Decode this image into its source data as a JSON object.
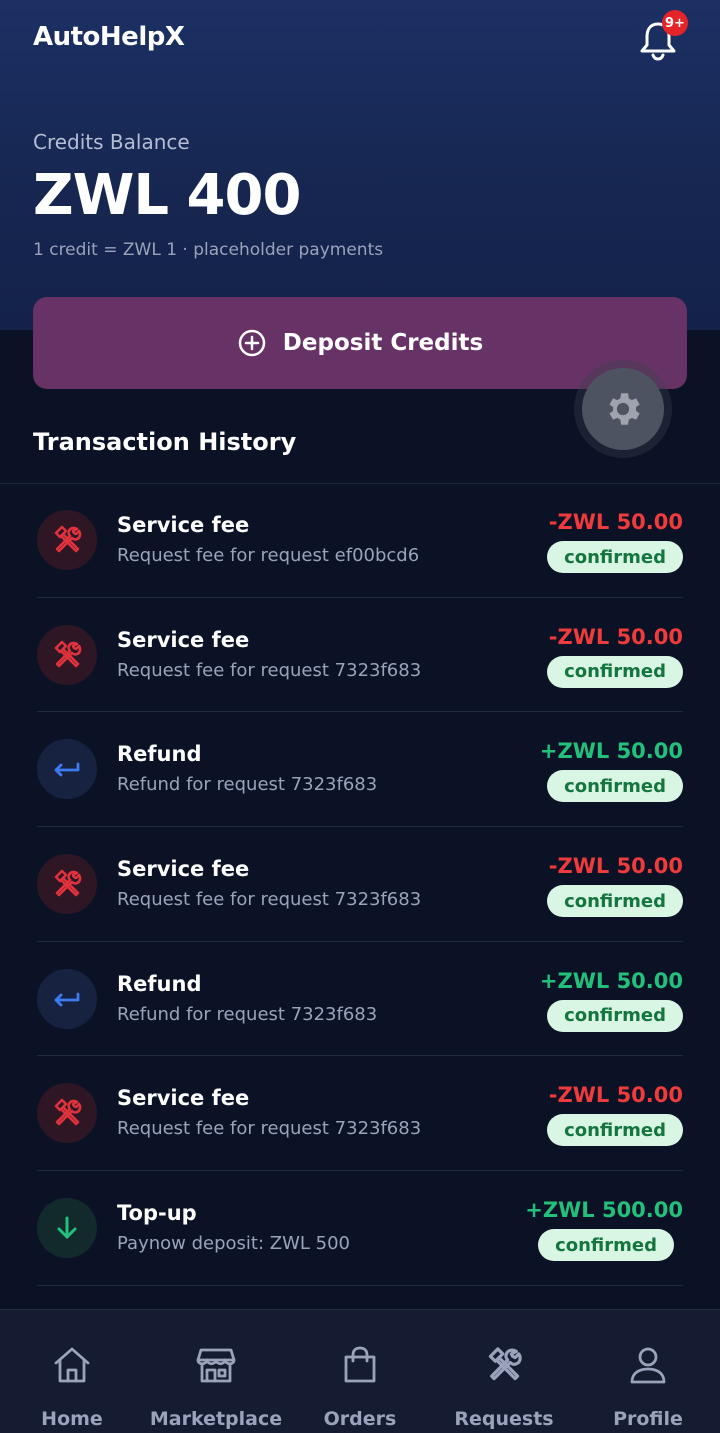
{
  "header": {
    "app_title": "AutoHelpX",
    "notification_badge": "9+"
  },
  "balance": {
    "label": "Credits Balance",
    "value": "ZWL 400",
    "note": "1 credit = ZWL 1 · placeholder payments"
  },
  "deposit": {
    "label": "Deposit Credits"
  },
  "history": {
    "title": "Transaction History",
    "transactions": [
      {
        "type": "fee",
        "icon": "tools-icon",
        "title": "Service fee",
        "description": "Request fee for request ef00bcd6",
        "amount": "-ZWL 50.00",
        "status": "confirmed"
      },
      {
        "type": "fee",
        "icon": "tools-icon",
        "title": "Service fee",
        "description": "Request fee for request 7323f683",
        "amount": "-ZWL 50.00",
        "status": "confirmed"
      },
      {
        "type": "refund",
        "icon": "return-arrow-icon",
        "title": "Refund",
        "description": "Refund for request 7323f683",
        "amount": "+ZWL 50.00",
        "status": "confirmed"
      },
      {
        "type": "fee",
        "icon": "tools-icon",
        "title": "Service fee",
        "description": "Request fee for request 7323f683",
        "amount": "-ZWL 50.00",
        "status": "confirmed"
      },
      {
        "type": "refund",
        "icon": "return-arrow-icon",
        "title": "Refund",
        "description": "Refund for request 7323f683",
        "amount": "+ZWL 50.00",
        "status": "confirmed"
      },
      {
        "type": "fee",
        "icon": "tools-icon",
        "title": "Service fee",
        "description": "Request fee for request 7323f683",
        "amount": "-ZWL 50.00",
        "status": "confirmed"
      },
      {
        "type": "topup",
        "icon": "arrow-down-icon",
        "title": "Top-up",
        "description": "Paynow deposit: ZWL 500",
        "amount": "+ZWL 500.00",
        "status": "confirmed"
      }
    ]
  },
  "nav": {
    "items": [
      {
        "label": "Home",
        "icon": "home-icon"
      },
      {
        "label": "Marketplace",
        "icon": "store-icon"
      },
      {
        "label": "Orders",
        "icon": "shopping-bag-icon"
      },
      {
        "label": "Requests",
        "icon": "tools-icon"
      },
      {
        "label": "Profile",
        "icon": "user-icon"
      }
    ]
  },
  "colors": {
    "background": "#0c1226",
    "hero": "#1c3064",
    "deposit_button": "#673265",
    "negative": "#ef3b3b",
    "positive": "#22c07a",
    "status_bg": "#d9f5e4",
    "status_text": "#14753f"
  }
}
